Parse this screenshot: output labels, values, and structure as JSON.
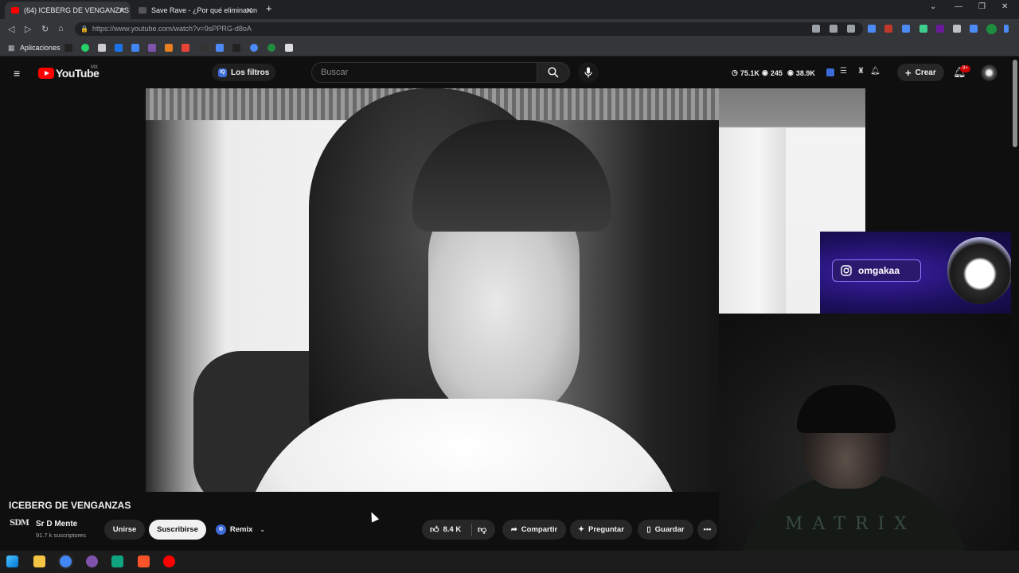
{
  "browser": {
    "tabs": [
      {
        "label": "(64) ICEBERG DE VENGANZAS",
        "favicon_color": "#ff0000",
        "active": true
      },
      {
        "label": "Save Rave - ¿Por qué eliminaron",
        "favicon_color": "#444444",
        "active": false
      }
    ],
    "new_tab_label": "+",
    "url_host": "https://www.youtube.com",
    "url_path": "/watch?v=9sPPRG-d8oA",
    "bookmarks_label": "Aplicaciones"
  },
  "youtube": {
    "logo_text": "YouTube",
    "region": "MX",
    "filters_label": "Los filtros",
    "filters_badge": "IQ",
    "search_placeholder": "Buscar",
    "stats": [
      {
        "icon": "clock-icon",
        "value": "75.1K"
      },
      {
        "icon": "eye-icon",
        "value": "245"
      },
      {
        "icon": "eye-icon",
        "value": "38.9K"
      }
    ],
    "create_label": "Crear",
    "notifications_badge": "9+"
  },
  "video": {
    "title": "ICEBERG DE VENGANZAS",
    "channel_logo": "SDM",
    "channel_name": "Sr D Mente",
    "subscribers": "91.7 k suscriptores",
    "join_label": "Unirse",
    "subscribe_label": "Suscribirse",
    "remix_label": "Remix",
    "likes": "8.4 K",
    "share_label": "Compartir",
    "ask_label": "Preguntar",
    "save_label": "Guardar"
  },
  "overlay": {
    "instagram_handle": "omgakaa",
    "shirt_text": "MATRIX"
  },
  "colors": {
    "youtube_red": "#ff0000",
    "background": "#0f0f0f",
    "overlay_purple": "#2a1a6e"
  }
}
